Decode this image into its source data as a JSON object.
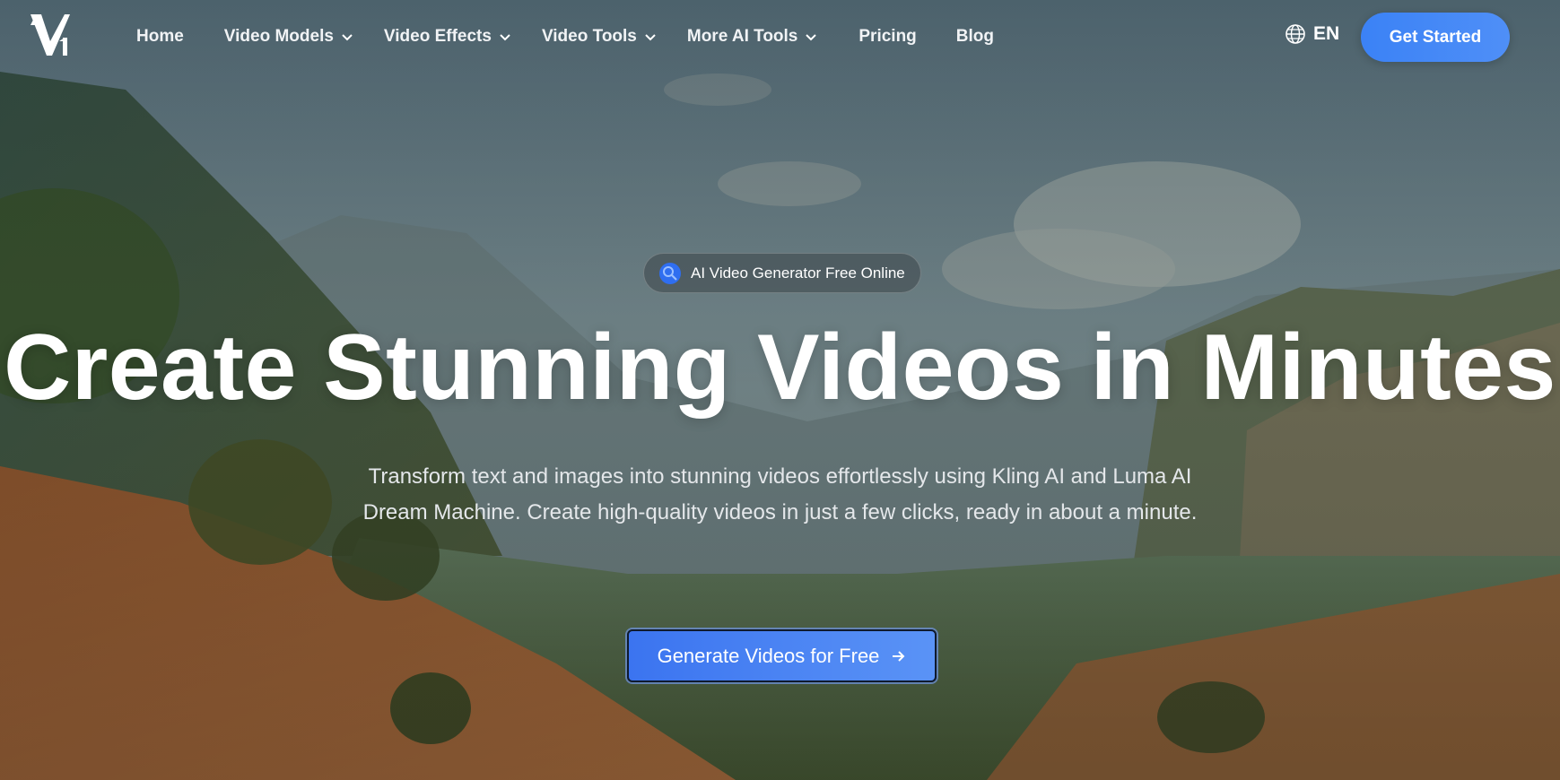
{
  "brand": {
    "logo_text": "V1"
  },
  "nav": {
    "items": [
      {
        "label": "Home",
        "has_dropdown": false
      },
      {
        "label": "Video Models",
        "has_dropdown": true
      },
      {
        "label": "Video Effects",
        "has_dropdown": true
      },
      {
        "label": "Video Tools",
        "has_dropdown": true
      },
      {
        "label": "More AI Tools",
        "has_dropdown": true
      },
      {
        "label": "Pricing",
        "has_dropdown": false
      },
      {
        "label": "Blog",
        "has_dropdown": false
      }
    ],
    "language": "EN",
    "get_started": "Get Started"
  },
  "hero": {
    "badge": "AI Video Generator Free Online",
    "headline": "Create Stunning Videos in Minutes",
    "subtitle": "Transform text and images into stunning videos effortlessly using Kling AI and Luma AI Dream Machine. Create high-quality videos in just a few clicks, ready in about a minute.",
    "cta": "Generate Videos for Free"
  },
  "colors": {
    "accent": "#3b82f6",
    "cta_start": "#3b74f0",
    "cta_end": "#5a93f6"
  },
  "icons": {
    "logo": "v1-logo-icon",
    "language": "globe-icon",
    "dropdown": "chevron-down-icon",
    "badge": "sparkle-icon",
    "cta_arrow": "arrow-right-icon"
  }
}
